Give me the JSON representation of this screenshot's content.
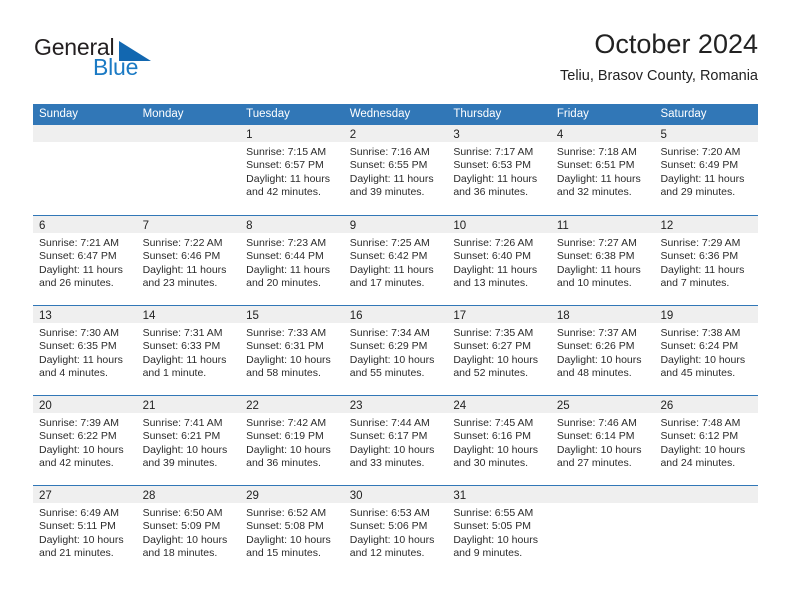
{
  "brand": {
    "name_part1": "General",
    "name_part2": "Blue",
    "colors": {
      "dark": "#231f20",
      "blue": "#1b7ac4",
      "triangle": "#1267b0"
    }
  },
  "header": {
    "month_title": "October 2024",
    "location": "Teliu, Brasov County, Romania"
  },
  "theme": {
    "header_blue": "#3177b7",
    "day_band_gray": "#efefef",
    "text_dark": "#222222"
  },
  "weekdays": [
    {
      "label": "Sunday"
    },
    {
      "label": "Monday"
    },
    {
      "label": "Tuesday"
    },
    {
      "label": "Wednesday"
    },
    {
      "label": "Thursday"
    },
    {
      "label": "Friday"
    },
    {
      "label": "Saturday"
    }
  ],
  "weeks": [
    {
      "days": [
        {
          "number": "",
          "empty": true,
          "sunrise": "",
          "sunset": "",
          "daylight_line1": "",
          "daylight_line2": ""
        },
        {
          "number": "",
          "empty": true,
          "sunrise": "",
          "sunset": "",
          "daylight_line1": "",
          "daylight_line2": ""
        },
        {
          "number": "1",
          "empty": false,
          "sunrise": "Sunrise: 7:15 AM",
          "sunset": "Sunset: 6:57 PM",
          "daylight_line1": "Daylight: 11 hours",
          "daylight_line2": "and 42 minutes."
        },
        {
          "number": "2",
          "empty": false,
          "sunrise": "Sunrise: 7:16 AM",
          "sunset": "Sunset: 6:55 PM",
          "daylight_line1": "Daylight: 11 hours",
          "daylight_line2": "and 39 minutes."
        },
        {
          "number": "3",
          "empty": false,
          "sunrise": "Sunrise: 7:17 AM",
          "sunset": "Sunset: 6:53 PM",
          "daylight_line1": "Daylight: 11 hours",
          "daylight_line2": "and 36 minutes."
        },
        {
          "number": "4",
          "empty": false,
          "sunrise": "Sunrise: 7:18 AM",
          "sunset": "Sunset: 6:51 PM",
          "daylight_line1": "Daylight: 11 hours",
          "daylight_line2": "and 32 minutes."
        },
        {
          "number": "5",
          "empty": false,
          "sunrise": "Sunrise: 7:20 AM",
          "sunset": "Sunset: 6:49 PM",
          "daylight_line1": "Daylight: 11 hours",
          "daylight_line2": "and 29 minutes."
        }
      ]
    },
    {
      "days": [
        {
          "number": "6",
          "empty": false,
          "sunrise": "Sunrise: 7:21 AM",
          "sunset": "Sunset: 6:47 PM",
          "daylight_line1": "Daylight: 11 hours",
          "daylight_line2": "and 26 minutes."
        },
        {
          "number": "7",
          "empty": false,
          "sunrise": "Sunrise: 7:22 AM",
          "sunset": "Sunset: 6:46 PM",
          "daylight_line1": "Daylight: 11 hours",
          "daylight_line2": "and 23 minutes."
        },
        {
          "number": "8",
          "empty": false,
          "sunrise": "Sunrise: 7:23 AM",
          "sunset": "Sunset: 6:44 PM",
          "daylight_line1": "Daylight: 11 hours",
          "daylight_line2": "and 20 minutes."
        },
        {
          "number": "9",
          "empty": false,
          "sunrise": "Sunrise: 7:25 AM",
          "sunset": "Sunset: 6:42 PM",
          "daylight_line1": "Daylight: 11 hours",
          "daylight_line2": "and 17 minutes."
        },
        {
          "number": "10",
          "empty": false,
          "sunrise": "Sunrise: 7:26 AM",
          "sunset": "Sunset: 6:40 PM",
          "daylight_line1": "Daylight: 11 hours",
          "daylight_line2": "and 13 minutes."
        },
        {
          "number": "11",
          "empty": false,
          "sunrise": "Sunrise: 7:27 AM",
          "sunset": "Sunset: 6:38 PM",
          "daylight_line1": "Daylight: 11 hours",
          "daylight_line2": "and 10 minutes."
        },
        {
          "number": "12",
          "empty": false,
          "sunrise": "Sunrise: 7:29 AM",
          "sunset": "Sunset: 6:36 PM",
          "daylight_line1": "Daylight: 11 hours",
          "daylight_line2": "and 7 minutes."
        }
      ]
    },
    {
      "days": [
        {
          "number": "13",
          "empty": false,
          "sunrise": "Sunrise: 7:30 AM",
          "sunset": "Sunset: 6:35 PM",
          "daylight_line1": "Daylight: 11 hours",
          "daylight_line2": "and 4 minutes."
        },
        {
          "number": "14",
          "empty": false,
          "sunrise": "Sunrise: 7:31 AM",
          "sunset": "Sunset: 6:33 PM",
          "daylight_line1": "Daylight: 11 hours",
          "daylight_line2": "and 1 minute."
        },
        {
          "number": "15",
          "empty": false,
          "sunrise": "Sunrise: 7:33 AM",
          "sunset": "Sunset: 6:31 PM",
          "daylight_line1": "Daylight: 10 hours",
          "daylight_line2": "and 58 minutes."
        },
        {
          "number": "16",
          "empty": false,
          "sunrise": "Sunrise: 7:34 AM",
          "sunset": "Sunset: 6:29 PM",
          "daylight_line1": "Daylight: 10 hours",
          "daylight_line2": "and 55 minutes."
        },
        {
          "number": "17",
          "empty": false,
          "sunrise": "Sunrise: 7:35 AM",
          "sunset": "Sunset: 6:27 PM",
          "daylight_line1": "Daylight: 10 hours",
          "daylight_line2": "and 52 minutes."
        },
        {
          "number": "18",
          "empty": false,
          "sunrise": "Sunrise: 7:37 AM",
          "sunset": "Sunset: 6:26 PM",
          "daylight_line1": "Daylight: 10 hours",
          "daylight_line2": "and 48 minutes."
        },
        {
          "number": "19",
          "empty": false,
          "sunrise": "Sunrise: 7:38 AM",
          "sunset": "Sunset: 6:24 PM",
          "daylight_line1": "Daylight: 10 hours",
          "daylight_line2": "and 45 minutes."
        }
      ]
    },
    {
      "days": [
        {
          "number": "20",
          "empty": false,
          "sunrise": "Sunrise: 7:39 AM",
          "sunset": "Sunset: 6:22 PM",
          "daylight_line1": "Daylight: 10 hours",
          "daylight_line2": "and 42 minutes."
        },
        {
          "number": "21",
          "empty": false,
          "sunrise": "Sunrise: 7:41 AM",
          "sunset": "Sunset: 6:21 PM",
          "daylight_line1": "Daylight: 10 hours",
          "daylight_line2": "and 39 minutes."
        },
        {
          "number": "22",
          "empty": false,
          "sunrise": "Sunrise: 7:42 AM",
          "sunset": "Sunset: 6:19 PM",
          "daylight_line1": "Daylight: 10 hours",
          "daylight_line2": "and 36 minutes."
        },
        {
          "number": "23",
          "empty": false,
          "sunrise": "Sunrise: 7:44 AM",
          "sunset": "Sunset: 6:17 PM",
          "daylight_line1": "Daylight: 10 hours",
          "daylight_line2": "and 33 minutes."
        },
        {
          "number": "24",
          "empty": false,
          "sunrise": "Sunrise: 7:45 AM",
          "sunset": "Sunset: 6:16 PM",
          "daylight_line1": "Daylight: 10 hours",
          "daylight_line2": "and 30 minutes."
        },
        {
          "number": "25",
          "empty": false,
          "sunrise": "Sunrise: 7:46 AM",
          "sunset": "Sunset: 6:14 PM",
          "daylight_line1": "Daylight: 10 hours",
          "daylight_line2": "and 27 minutes."
        },
        {
          "number": "26",
          "empty": false,
          "sunrise": "Sunrise: 7:48 AM",
          "sunset": "Sunset: 6:12 PM",
          "daylight_line1": "Daylight: 10 hours",
          "daylight_line2": "and 24 minutes."
        }
      ]
    },
    {
      "days": [
        {
          "number": "27",
          "empty": false,
          "sunrise": "Sunrise: 6:49 AM",
          "sunset": "Sunset: 5:11 PM",
          "daylight_line1": "Daylight: 10 hours",
          "daylight_line2": "and 21 minutes."
        },
        {
          "number": "28",
          "empty": false,
          "sunrise": "Sunrise: 6:50 AM",
          "sunset": "Sunset: 5:09 PM",
          "daylight_line1": "Daylight: 10 hours",
          "daylight_line2": "and 18 minutes."
        },
        {
          "number": "29",
          "empty": false,
          "sunrise": "Sunrise: 6:52 AM",
          "sunset": "Sunset: 5:08 PM",
          "daylight_line1": "Daylight: 10 hours",
          "daylight_line2": "and 15 minutes."
        },
        {
          "number": "30",
          "empty": false,
          "sunrise": "Sunrise: 6:53 AM",
          "sunset": "Sunset: 5:06 PM",
          "daylight_line1": "Daylight: 10 hours",
          "daylight_line2": "and 12 minutes."
        },
        {
          "number": "31",
          "empty": false,
          "sunrise": "Sunrise: 6:55 AM",
          "sunset": "Sunset: 5:05 PM",
          "daylight_line1": "Daylight: 10 hours",
          "daylight_line2": "and 9 minutes."
        },
        {
          "number": "",
          "empty": true,
          "sunrise": "",
          "sunset": "",
          "daylight_line1": "",
          "daylight_line2": ""
        },
        {
          "number": "",
          "empty": true,
          "sunrise": "",
          "sunset": "",
          "daylight_line1": "",
          "daylight_line2": ""
        }
      ]
    }
  ]
}
